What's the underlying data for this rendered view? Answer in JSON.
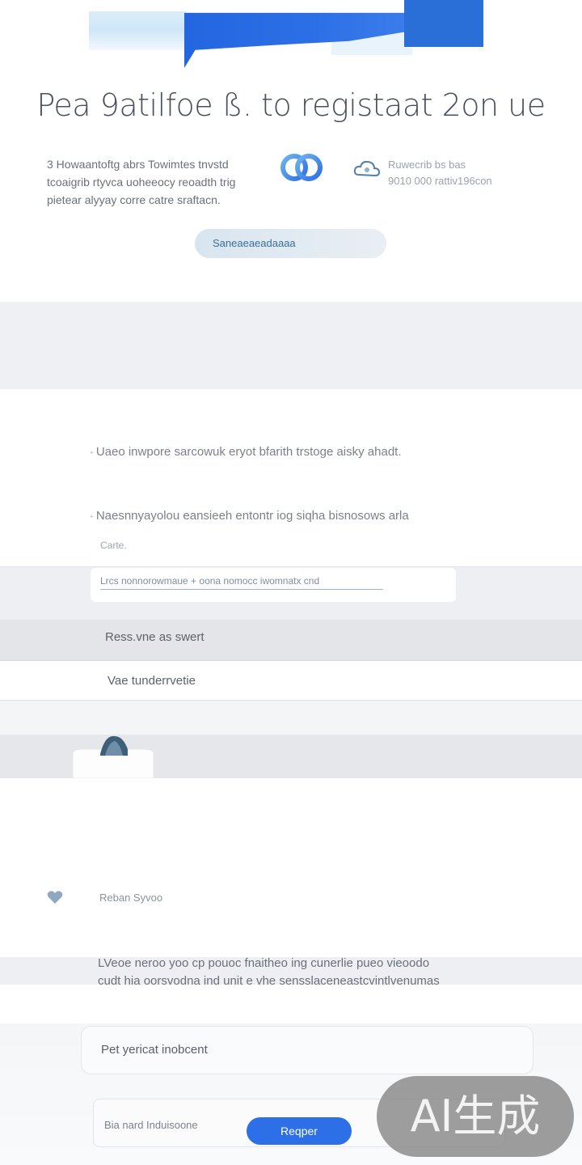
{
  "header": {
    "title": "Pea 9atilfoe ß. to registaat 2on ue"
  },
  "intro": {
    "lines": [
      "3 Howaantoftg abrs Towimtes tnvstd",
      "tcoaigrib rtyvca uoheeocy reoadth trig",
      "pietear alyyay corre catre sraftacn."
    ]
  },
  "stats": {
    "line1": "Ruwecrib bs bas",
    "line2": "9010 000 rattiv196con"
  },
  "pill_button": {
    "label": "Saneaeaeadaaaa"
  },
  "bullets": [
    "Uaeo inwpore sarcowuk eryot bfarith trstoge aisky ahadt.",
    "Naesnnyayolou eansieeh entontr iog siqha bisnosows arla"
  ],
  "field": {
    "caption": "Carte.",
    "value": "Lrcs nonnorowmaue + oona nomocc iwomnatx cnd"
  },
  "options": {
    "opt1": "Ress.vne as swert",
    "opt2": "Vae tunderrvetie"
  },
  "reason": {
    "label": "Reban Syvoo"
  },
  "paragraph": {
    "line1": "LVeoe neroo yoo cp pouoc fnaitheo ing cunerlie pueo vieoodo",
    "line2": "cudt hia oorsvodna ind unit e vhe sensslaceneastcvintlvenumas"
  },
  "cards": {
    "card1_label": "Pet yericat inobcent",
    "card2_label": "Bia nard Induisoone",
    "register_label": "Reqper"
  },
  "badge": {
    "text": "AI生成"
  },
  "colors": {
    "accent": "#2d6fe6",
    "banner_blue": "#2a6fd8",
    "badge_gray": "#8c8c8c"
  }
}
